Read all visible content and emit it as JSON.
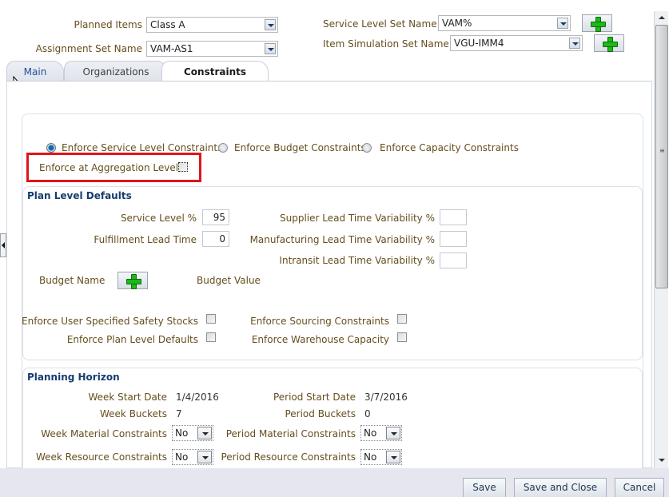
{
  "header": {
    "planned_items": {
      "label": "Planned Items",
      "value": "Class A"
    },
    "assignment_set": {
      "label": "Assignment Set Name",
      "value": "VAM-AS1"
    },
    "service_level_set": {
      "label": "Service Level Set Name",
      "value": "VAM%"
    },
    "item_simulation_set": {
      "label": "Item Simulation Set Name",
      "value": "VGU-IMM4"
    }
  },
  "tabs": [
    {
      "label": "Main",
      "active": false
    },
    {
      "label": "Organizations",
      "active": false
    },
    {
      "label": "Constraints",
      "active": true
    }
  ],
  "constraints": {
    "radios": [
      {
        "label": "Enforce Service Level Constraints",
        "selected": true
      },
      {
        "label": "Enforce Budget Constraints",
        "selected": false
      },
      {
        "label": "Enforce Capacity Constraints",
        "selected": false
      }
    ],
    "aggregation": {
      "label": "Enforce at Aggregation Level",
      "checked": false
    }
  },
  "plan_level_defaults": {
    "title": "Plan Level Defaults",
    "service_level": {
      "label": "Service Level %",
      "value": "95"
    },
    "fulfillment_lead_time": {
      "label": "Fulfillment Lead Time",
      "value": "0"
    },
    "supplier_variability": {
      "label": "Supplier Lead Time Variability %",
      "value": ""
    },
    "manufacturing_variability": {
      "label": "Manufacturing Lead Time Variability %",
      "value": ""
    },
    "intransit_variability": {
      "label": "Intransit Lead Time Variability %",
      "value": ""
    },
    "budget_name": {
      "label": "Budget Name"
    },
    "budget_value": {
      "label": "Budget Value"
    },
    "checks": [
      {
        "label": "Enforce User Specified Safety Stocks",
        "checked": false
      },
      {
        "label": "Enforce Plan Level Defaults",
        "checked": false
      },
      {
        "label": "Enforce Sourcing Constraints",
        "checked": false
      },
      {
        "label": "Enforce Warehouse Capacity",
        "checked": false
      }
    ]
  },
  "planning_horizon": {
    "title": "Planning Horizon",
    "week_start_date": {
      "label": "Week Start Date",
      "value": "1/4/2016"
    },
    "week_buckets": {
      "label": "Week Buckets",
      "value": "7"
    },
    "week_material": {
      "label": "Week Material Constraints",
      "value": "No"
    },
    "week_resource": {
      "label": "Week Resource Constraints",
      "value": "No"
    },
    "period_start_date": {
      "label": "Period Start Date",
      "value": "3/7/2016"
    },
    "period_buckets": {
      "label": "Period Buckets",
      "value": "0"
    },
    "period_material": {
      "label": "Period Material Constraints",
      "value": "No"
    },
    "period_resource": {
      "label": "Period Resource Constraints",
      "value": "No"
    }
  },
  "footer": {
    "save": "Save",
    "save_and_close": "Save and Close",
    "cancel": "Cancel"
  },
  "colors": {
    "label": "#654e1c",
    "section_header": "#153d6e",
    "highlight": "#e0141b",
    "add_icon": "#1fb81a"
  }
}
